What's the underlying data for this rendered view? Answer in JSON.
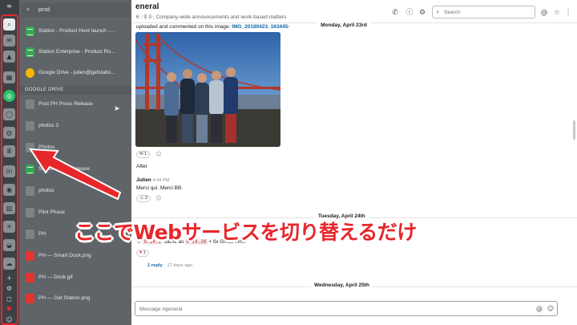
{
  "colors": {
    "annotation": "#e8262b",
    "dock": "#3c4145",
    "panel": "#5f6468",
    "link": "#1264a3"
  },
  "search": {
    "query": "prod"
  },
  "results": [
    {
      "type": "sheet",
      "label": "Station - Product Hunt launch -..."
    },
    {
      "type": "sheet",
      "label": "Station Enterprise - Product Ro..."
    },
    {
      "type": "drive",
      "label": "Google Drive - julien@getstatio..."
    }
  ],
  "google_drive_section": {
    "title": "GOOGLE DRIVE",
    "items": [
      {
        "type": "folder",
        "label": "Post PH Press Release"
      },
      {
        "type": "folder",
        "label": "photos 3"
      },
      {
        "type": "folder",
        "label": "Photos"
      },
      {
        "type": "sheet",
        "label": "Station PH ... Release"
      },
      {
        "type": "folder",
        "label": "photos"
      },
      {
        "type": "folder",
        "label": "Pilot Phase"
      },
      {
        "type": "folder",
        "label": "PH"
      },
      {
        "type": "img",
        "label": "PH — Smart Dock.png"
      },
      {
        "type": "img",
        "label": "PH — Dock.gif"
      },
      {
        "type": "img",
        "label": "PH — Get Station.png"
      }
    ]
  },
  "channel": {
    "title": "eneral",
    "members": "6",
    "pins": "0",
    "topic": "Company-wide announcements and work-based matters"
  },
  "header": {
    "search_placeholder": "Search"
  },
  "messages": {
    "day_1": "Monday, April 23rd",
    "upload_text": "uploaded and commented on this image:",
    "upload_file": "IMG_20180423_163445-",
    "reaction_1": "1",
    "after_text": "After",
    "julien_name": "Julien",
    "julien_time": "4:44 PM",
    "julien_text": "Merci qui. Merci BB.",
    "reaction_2": "2",
    "day_2": "Tuesday, April 24th",
    "code_prefix": "Same as",
    "code_1": "0.14.2",
    "code_2": "0.14.26",
    "code_suffix": "+ fix Gmail error",
    "reaction_3": "1",
    "reply_count": "1 reply",
    "reply_age": "17 days ago",
    "day_3": "Wednesday, April 25th"
  },
  "composer": {
    "placeholder": "Message #general"
  },
  "annotation": {
    "caption": "ここでWebサービスを切り替えるだけ"
  }
}
